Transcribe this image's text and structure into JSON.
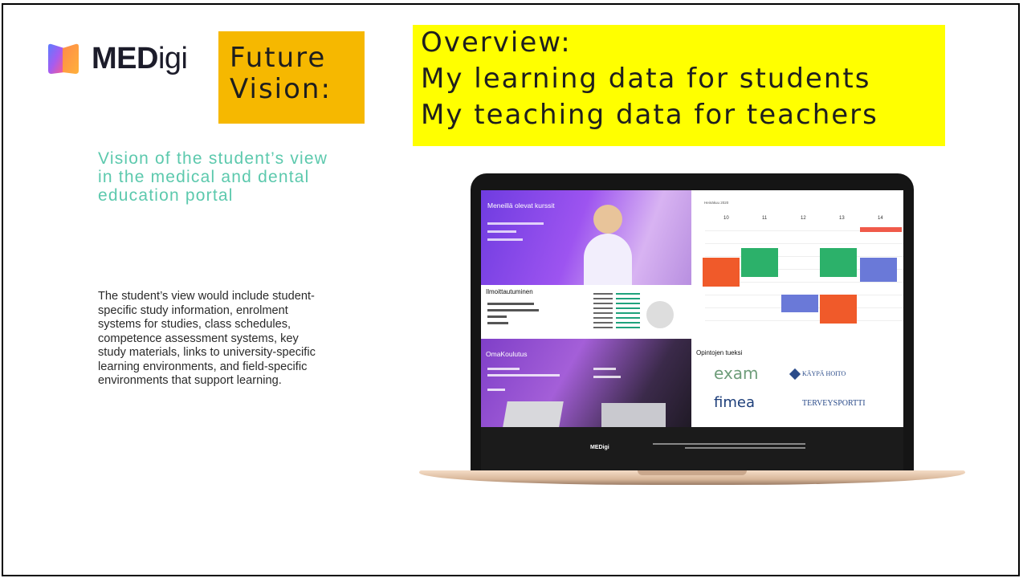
{
  "logo": {
    "brand_bold": "MED",
    "brand_light": "igi"
  },
  "future_vision": {
    "line1": "Future",
    "line2": "Vision:"
  },
  "overview": {
    "line1": "Overview:",
    "line2": "My learning data for students",
    "line3": "My teaching data for teachers"
  },
  "vision": {
    "line1": "Vision of the student’s view",
    "line2": "in the medical and dental",
    "line3": "education portal"
  },
  "description": [
    "The student’s view would include student-",
    "specific study information, enrolment",
    "systems for studies, class schedules,",
    "competence assessment systems, key",
    "study materials, links to university-specific",
    "learning environments, and field-specific",
    "environments that support learning."
  ],
  "screen": {
    "ongoing_courses": "Meneillä olevat kurssit",
    "registration": "Ilmoittautuminen",
    "oma": "OmaKoulutus",
    "calendar_month": "Heinäkuu 2020",
    "days": [
      "10",
      "11",
      "12",
      "13",
      "14"
    ],
    "support": "Opintojen tueksi",
    "logos": {
      "exam": "exam",
      "fimea": "fimea",
      "kaypa": "KÄYPÄ HOITO",
      "terveys": "TERVEYSPORTTI"
    },
    "footer_brand": "MEDigi"
  },
  "colors": {
    "future_bg": "#f6b800",
    "overview_bg": "#ffff00",
    "vision_text": "#5cc9ad"
  }
}
